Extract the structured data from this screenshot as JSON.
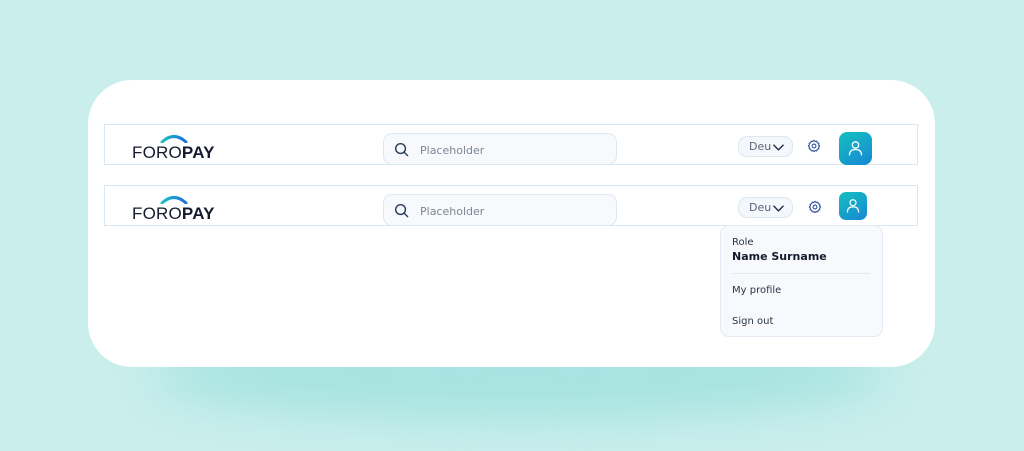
{
  "brand": {
    "logo_text_light": "FORO",
    "logo_text_bold": "PAY"
  },
  "search": {
    "placeholder": "Placeholder"
  },
  "language": {
    "selected": "Deu"
  },
  "user_menu": {
    "role": "Role",
    "name": "Name Surname",
    "items": [
      {
        "label": "My profile"
      },
      {
        "label": "Sign out"
      }
    ]
  },
  "icons": {
    "search": "search-icon",
    "chevron": "chevron-down-icon",
    "settings": "gear-icon",
    "user": "user-icon",
    "logo_arc": "logo-arc-icon"
  },
  "colors": {
    "page_background": "#c9eeec",
    "card_background": "#ffffff",
    "avatar_gradient_start": "#15c0bf",
    "avatar_gradient_end": "#1687d4",
    "logo_arc_start": "#19c2c5",
    "logo_arc_end": "#1d6fd8",
    "icon_blue": "#2a4a9c"
  }
}
